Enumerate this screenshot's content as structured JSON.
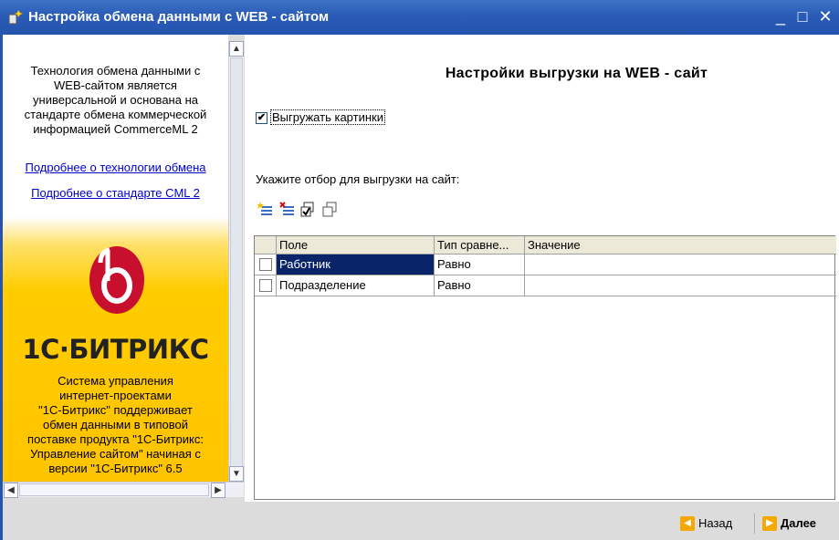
{
  "window": {
    "title": "Настройка обмена данными с WEB - сайтом",
    "minimize": "_",
    "maximize": "□",
    "close": "✕"
  },
  "left_panel": {
    "intro": [
      "Технология обмена данными с",
      "WEB-сайтом является",
      "универсальной и основана на",
      "стандарте обмена коммерческой",
      "информацией CommerceML 2"
    ],
    "link_technology": "Подробнее о технологии обмена",
    "link_standard": "Подробнее о стандарте CML 2",
    "brand": "1С·БИТРИКС",
    "promo": [
      "Система управления",
      "интернет-проектами",
      "\"1С-Битрикс\" поддерживает",
      "обмен данными в типовой",
      "поставке продукта \"1С-Битрикс:",
      "Управление сайтом\" начиная с",
      "версии \"1С-Битрикс\" 6.5"
    ]
  },
  "main": {
    "heading": "Настройки выгрузки на WEB - сайт",
    "export_images": {
      "label": "Выгружать картинки",
      "checked": true,
      "mark": "✔"
    },
    "filter_label": "Укажите отбор для выгрузки на сайт:",
    "toolbar": [
      "add-filter-icon",
      "delete-filter-icon",
      "check-all-icon",
      "uncheck-all-icon"
    ],
    "table": {
      "columns": [
        "Поле",
        "Тип сравне...",
        "Значение"
      ],
      "rows": [
        {
          "field": "Работник",
          "comparison": "Равно",
          "value": "",
          "checked": false,
          "selected": true
        },
        {
          "field": "Подразделение",
          "comparison": "Равно",
          "value": "",
          "checked": false,
          "selected": false
        }
      ]
    }
  },
  "footer": {
    "back": "Назад",
    "next": "Далее"
  },
  "colors": {
    "title_bar": "#2a5bb6",
    "selection": "#0a246a",
    "brand_logo": "#c8102e",
    "promo_bg": "#ffcc00",
    "nav_arrow": "#f5a800"
  }
}
